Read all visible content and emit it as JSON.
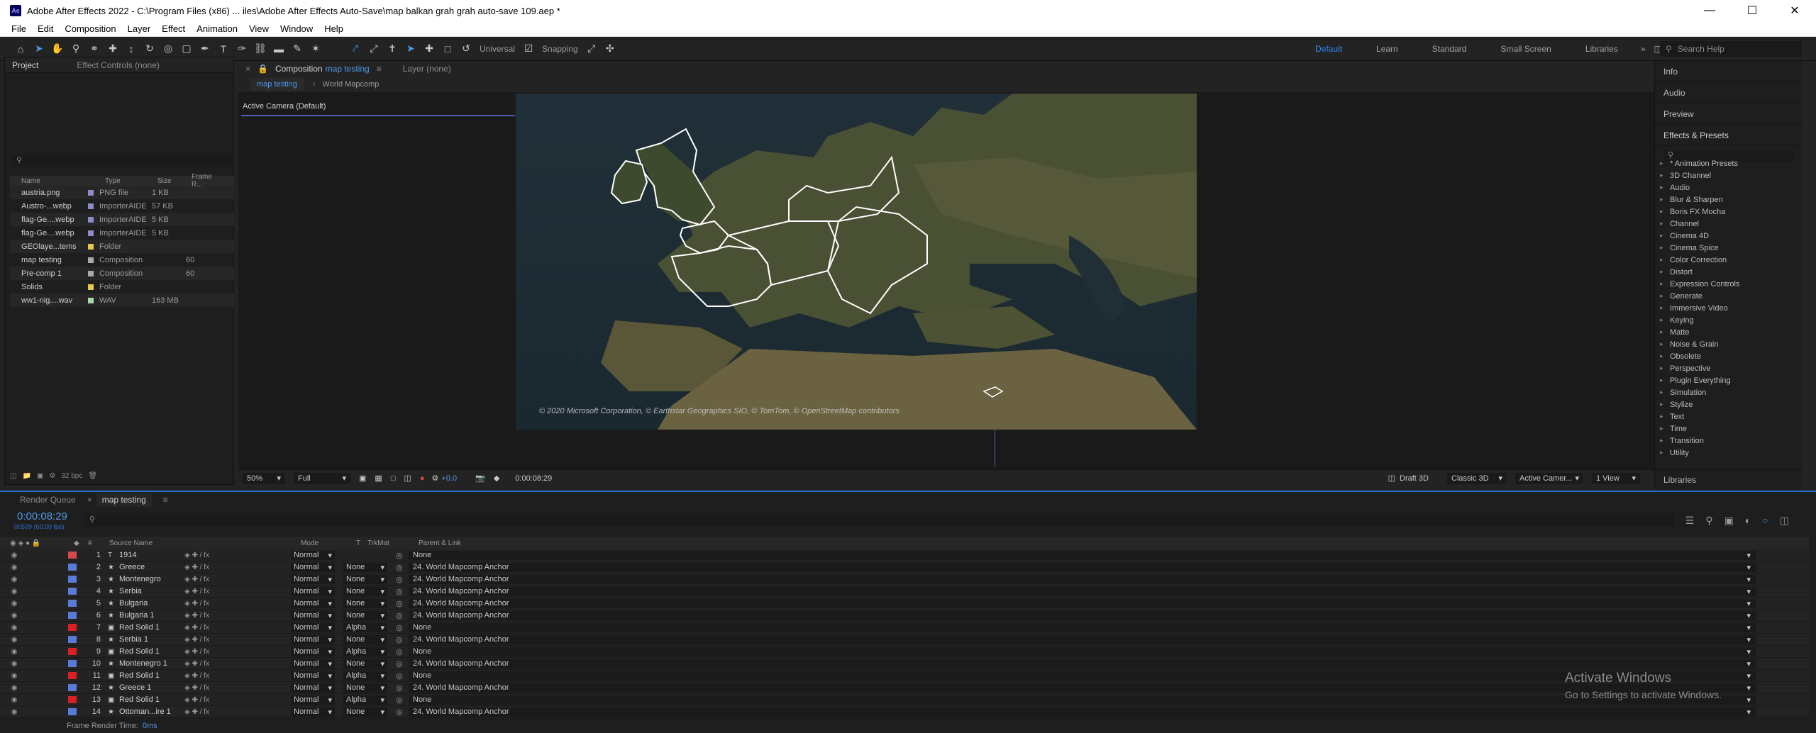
{
  "window": {
    "icon": "Ae",
    "title": "Adobe After Effects 2022 - C:\\Program Files (x86) ... iles\\Adobe After Effects Auto-Save\\map balkan grah grah auto-save 109.aep *"
  },
  "menu": [
    "File",
    "Edit",
    "Composition",
    "Layer",
    "Effect",
    "Animation",
    "View",
    "Window",
    "Help"
  ],
  "toolbar": {
    "universal_label": "Universal",
    "snapping_label": "Snapping",
    "workspaces": [
      "Default",
      "Learn",
      "Standard",
      "Small Screen",
      "Libraries"
    ],
    "active_workspace": "Default",
    "search_placeholder": "Search Help"
  },
  "project_panel": {
    "tabs": [
      "Project",
      "Effect Controls (none)"
    ],
    "columns": [
      "Name",
      "Type",
      "Size",
      "Frame R..."
    ],
    "items": [
      {
        "name": "austria.png",
        "color": "#8c8cc8",
        "type": "PNG file",
        "size": "1 KB",
        "frame": ""
      },
      {
        "name": "Austro-...webp",
        "color": "#8c8cc8",
        "type": "ImporterAIDE",
        "size": "57 KB",
        "frame": ""
      },
      {
        "name": "flag-Ge....webp",
        "color": "#8c8cc8",
        "type": "ImporterAIDE",
        "size": "5 KB",
        "frame": ""
      },
      {
        "name": "flag-Ge....webp",
        "color": "#8c8cc8",
        "type": "ImporterAIDE",
        "size": "5 KB",
        "frame": ""
      },
      {
        "name": "GEOlaye...tems",
        "color": "#e8c84a",
        "type": "Folder",
        "size": "",
        "frame": ""
      },
      {
        "name": "map testing",
        "color": "#a9a9a9",
        "type": "Composition",
        "size": "",
        "frame": "60"
      },
      {
        "name": "Pre-comp 1",
        "color": "#a9a9a9",
        "type": "Composition",
        "size": "",
        "frame": "60"
      },
      {
        "name": "Solids",
        "color": "#e8c84a",
        "type": "Folder",
        "size": "",
        "frame": ""
      },
      {
        "name": "ww1-nig....wav",
        "color": "#a8d8a8",
        "type": "WAV",
        "size": "163 MB",
        "frame": ""
      }
    ],
    "bpc": "32 bpc"
  },
  "composition": {
    "tab_label": "Composition",
    "tab_comp": "map testing",
    "layer_tab": "Layer (none)",
    "sub_tabs": [
      "map testing",
      "World Mapcomp"
    ],
    "camera": "Active Camera (Default)",
    "attribution": "© 2020 Microsoft Corporation, © Earthstar Geographics SIO, © TomTom, © OpenStreetMap contributors"
  },
  "viewer_footer": {
    "zoom": "50%",
    "resolution": "Full",
    "exposure": "+0.0",
    "timecode": "0:00:08:29",
    "renderer": "Draft 3D",
    "renderer_mode": "Classic 3D",
    "camera": "Active Camer...",
    "views": "1 View"
  },
  "right_panel": {
    "items": [
      "Info",
      "Audio",
      "Preview"
    ],
    "effects_title": "Effects & Presets",
    "effects": [
      "* Animation Presets",
      "3D Channel",
      "Audio",
      "Blur & Sharpen",
      "Boris FX Mocha",
      "Channel",
      "Cinema 4D",
      "Cinema Spice",
      "Color Correction",
      "Distort",
      "Expression Controls",
      "Generate",
      "Immersive Video",
      "Keying",
      "Matte",
      "Noise & Grain",
      "Obsolete",
      "Perspective",
      "Plugin Everything",
      "Simulation",
      "Stylize",
      "Text",
      "Time",
      "Transition",
      "Utility"
    ],
    "libraries": "Libraries"
  },
  "timeline": {
    "tabs": [
      "Render Queue",
      "map testing"
    ],
    "timecode": "0:00:08:29",
    "frames": "00509 (60.00 fps)",
    "columns": [
      "Source Name",
      "Mode",
      "T",
      "TrkMat",
      "Parent & Link"
    ],
    "layers": [
      {
        "num": "1",
        "icon": "T",
        "name": "1914",
        "color": "#d84a4a",
        "mode": "Normal",
        "trk": "",
        "parent": "None"
      },
      {
        "num": "2",
        "icon": "★",
        "name": "Greece",
        "color": "#5a7ad8",
        "mode": "Normal",
        "trk": "None",
        "parent": "24. World Mapcomp Anchor"
      },
      {
        "num": "3",
        "icon": "★",
        "name": "Montenegro",
        "color": "#5a7ad8",
        "mode": "Normal",
        "trk": "None",
        "parent": "24. World Mapcomp Anchor"
      },
      {
        "num": "4",
        "icon": "★",
        "name": "Serbia",
        "color": "#5a7ad8",
        "mode": "Normal",
        "trk": "None",
        "parent": "24. World Mapcomp Anchor"
      },
      {
        "num": "5",
        "icon": "★",
        "name": "Bulgaria",
        "color": "#5a7ad8",
        "mode": "Normal",
        "trk": "None",
        "parent": "24. World Mapcomp Anchor"
      },
      {
        "num": "6",
        "icon": "★",
        "name": "Bulgaria 1",
        "color": "#5a7ad8",
        "mode": "Normal",
        "trk": "None",
        "parent": "24. World Mapcomp Anchor"
      },
      {
        "num": "7",
        "icon": "▣",
        "name": "Red Solid 1",
        "color": "#d82020",
        "mode": "Normal",
        "trk": "Alpha",
        "parent": "None"
      },
      {
        "num": "8",
        "icon": "★",
        "name": "Serbia 1",
        "color": "#5a7ad8",
        "mode": "Normal",
        "trk": "None",
        "parent": "24. World Mapcomp Anchor"
      },
      {
        "num": "9",
        "icon": "▣",
        "name": "Red Solid 1",
        "color": "#d82020",
        "mode": "Normal",
        "trk": "Alpha",
        "parent": "None"
      },
      {
        "num": "10",
        "icon": "★",
        "name": "Montenegro 1",
        "color": "#5a7ad8",
        "mode": "Normal",
        "trk": "None",
        "parent": "24. World Mapcomp Anchor"
      },
      {
        "num": "11",
        "icon": "▣",
        "name": "Red Solid 1",
        "color": "#d82020",
        "mode": "Normal",
        "trk": "Alpha",
        "parent": "None"
      },
      {
        "num": "12",
        "icon": "★",
        "name": "Greece 1",
        "color": "#5a7ad8",
        "mode": "Normal",
        "trk": "None",
        "parent": "24. World Mapcomp Anchor"
      },
      {
        "num": "13",
        "icon": "▣",
        "name": "Red Solid 1",
        "color": "#d82020",
        "mode": "Normal",
        "trk": "Alpha",
        "parent": "None"
      },
      {
        "num": "14",
        "icon": "★",
        "name": "Ottoman...ire 1",
        "color": "#5a7ad8",
        "mode": "Normal",
        "trk": "None",
        "parent": "24. World Mapcomp Anchor"
      }
    ],
    "footer_label": "Frame Render Time:",
    "footer_value": "0ms"
  },
  "activate": {
    "line1": "Activate Windows",
    "line2": "Go to Settings to activate Windows."
  }
}
